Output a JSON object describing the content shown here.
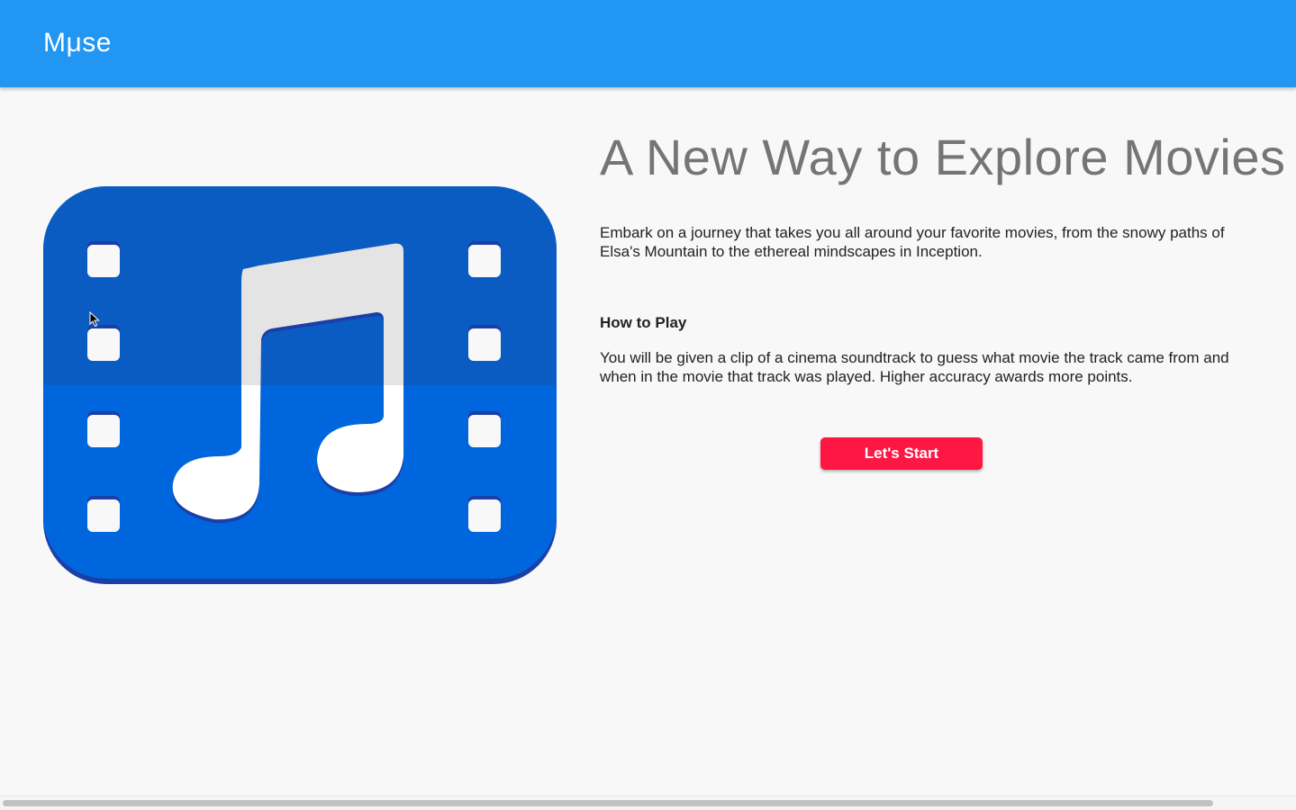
{
  "header": {
    "brand": "Mμse"
  },
  "hero": {
    "icon": "film-strip-music-note-icon"
  },
  "main": {
    "headline": "A New Way to Explore Movies",
    "intro": "Embark on a journey that takes you all around your favorite movies, from the snowy paths of Elsa's Mountain to the ethereal mindscapes in Inception.",
    "how_to_play_title": "How to Play",
    "how_to_play_text": "You will be given a clip of a cinema soundtrack to guess what movie the track came from and when in the movie that track was played. Higher accuracy awards more points.",
    "start_label": "Let's Start"
  },
  "colors": {
    "appbar": "#2296f3",
    "accent": "#ff1744",
    "icon_top": "#0b5cc2",
    "icon_bottom": "#0066dd"
  }
}
